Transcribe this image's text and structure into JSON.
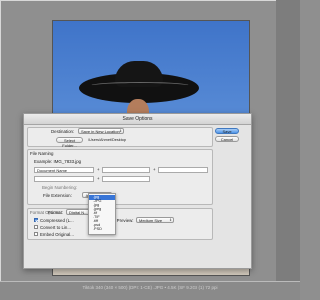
{
  "statusbar": {
    "text": "Tiktok 340 (340 × 500) (DPI: 1-CE) .JPG • 4.5K (SF 9.2GI (1) 72 ppi"
  },
  "dialog": {
    "title": "Save Options",
    "save_label": "Save",
    "cancel_label": "Cancel",
    "destination_label": "Destination:",
    "destination_value": "Save in New Location",
    "select_folder_label": "Select Folder...",
    "folder_path": "/Users/Ahmet/Desktop",
    "file_naming_title": "File Naming",
    "example_text": "Example: IMG_7833.jpg",
    "document_name_value": "Document Name",
    "plus_sign": "+",
    "begin_numbering_label": "Begin Numbering:",
    "file_extension_label": "File Extension:",
    "file_extension_value": ".jpg",
    "format_title": "Format Options",
    "format_label": "Format:",
    "format_value": "Digital N...",
    "compressed_label": "Compressed (L...",
    "convert_label": "Convert to Lin...",
    "embed_label": "Embed Original...",
    "jpeg_preview_label": "JPEG Preview:",
    "jpeg_preview_value": "Medium Size"
  },
  "extension_menu": {
    "items": [
      ".jpg",
      ".JPG",
      ".jpg",
      ".jpeg",
      ".tif",
      ".TIF",
      ".tiff",
      ".psd",
      ".PSD"
    ],
    "selected_index": 0
  }
}
